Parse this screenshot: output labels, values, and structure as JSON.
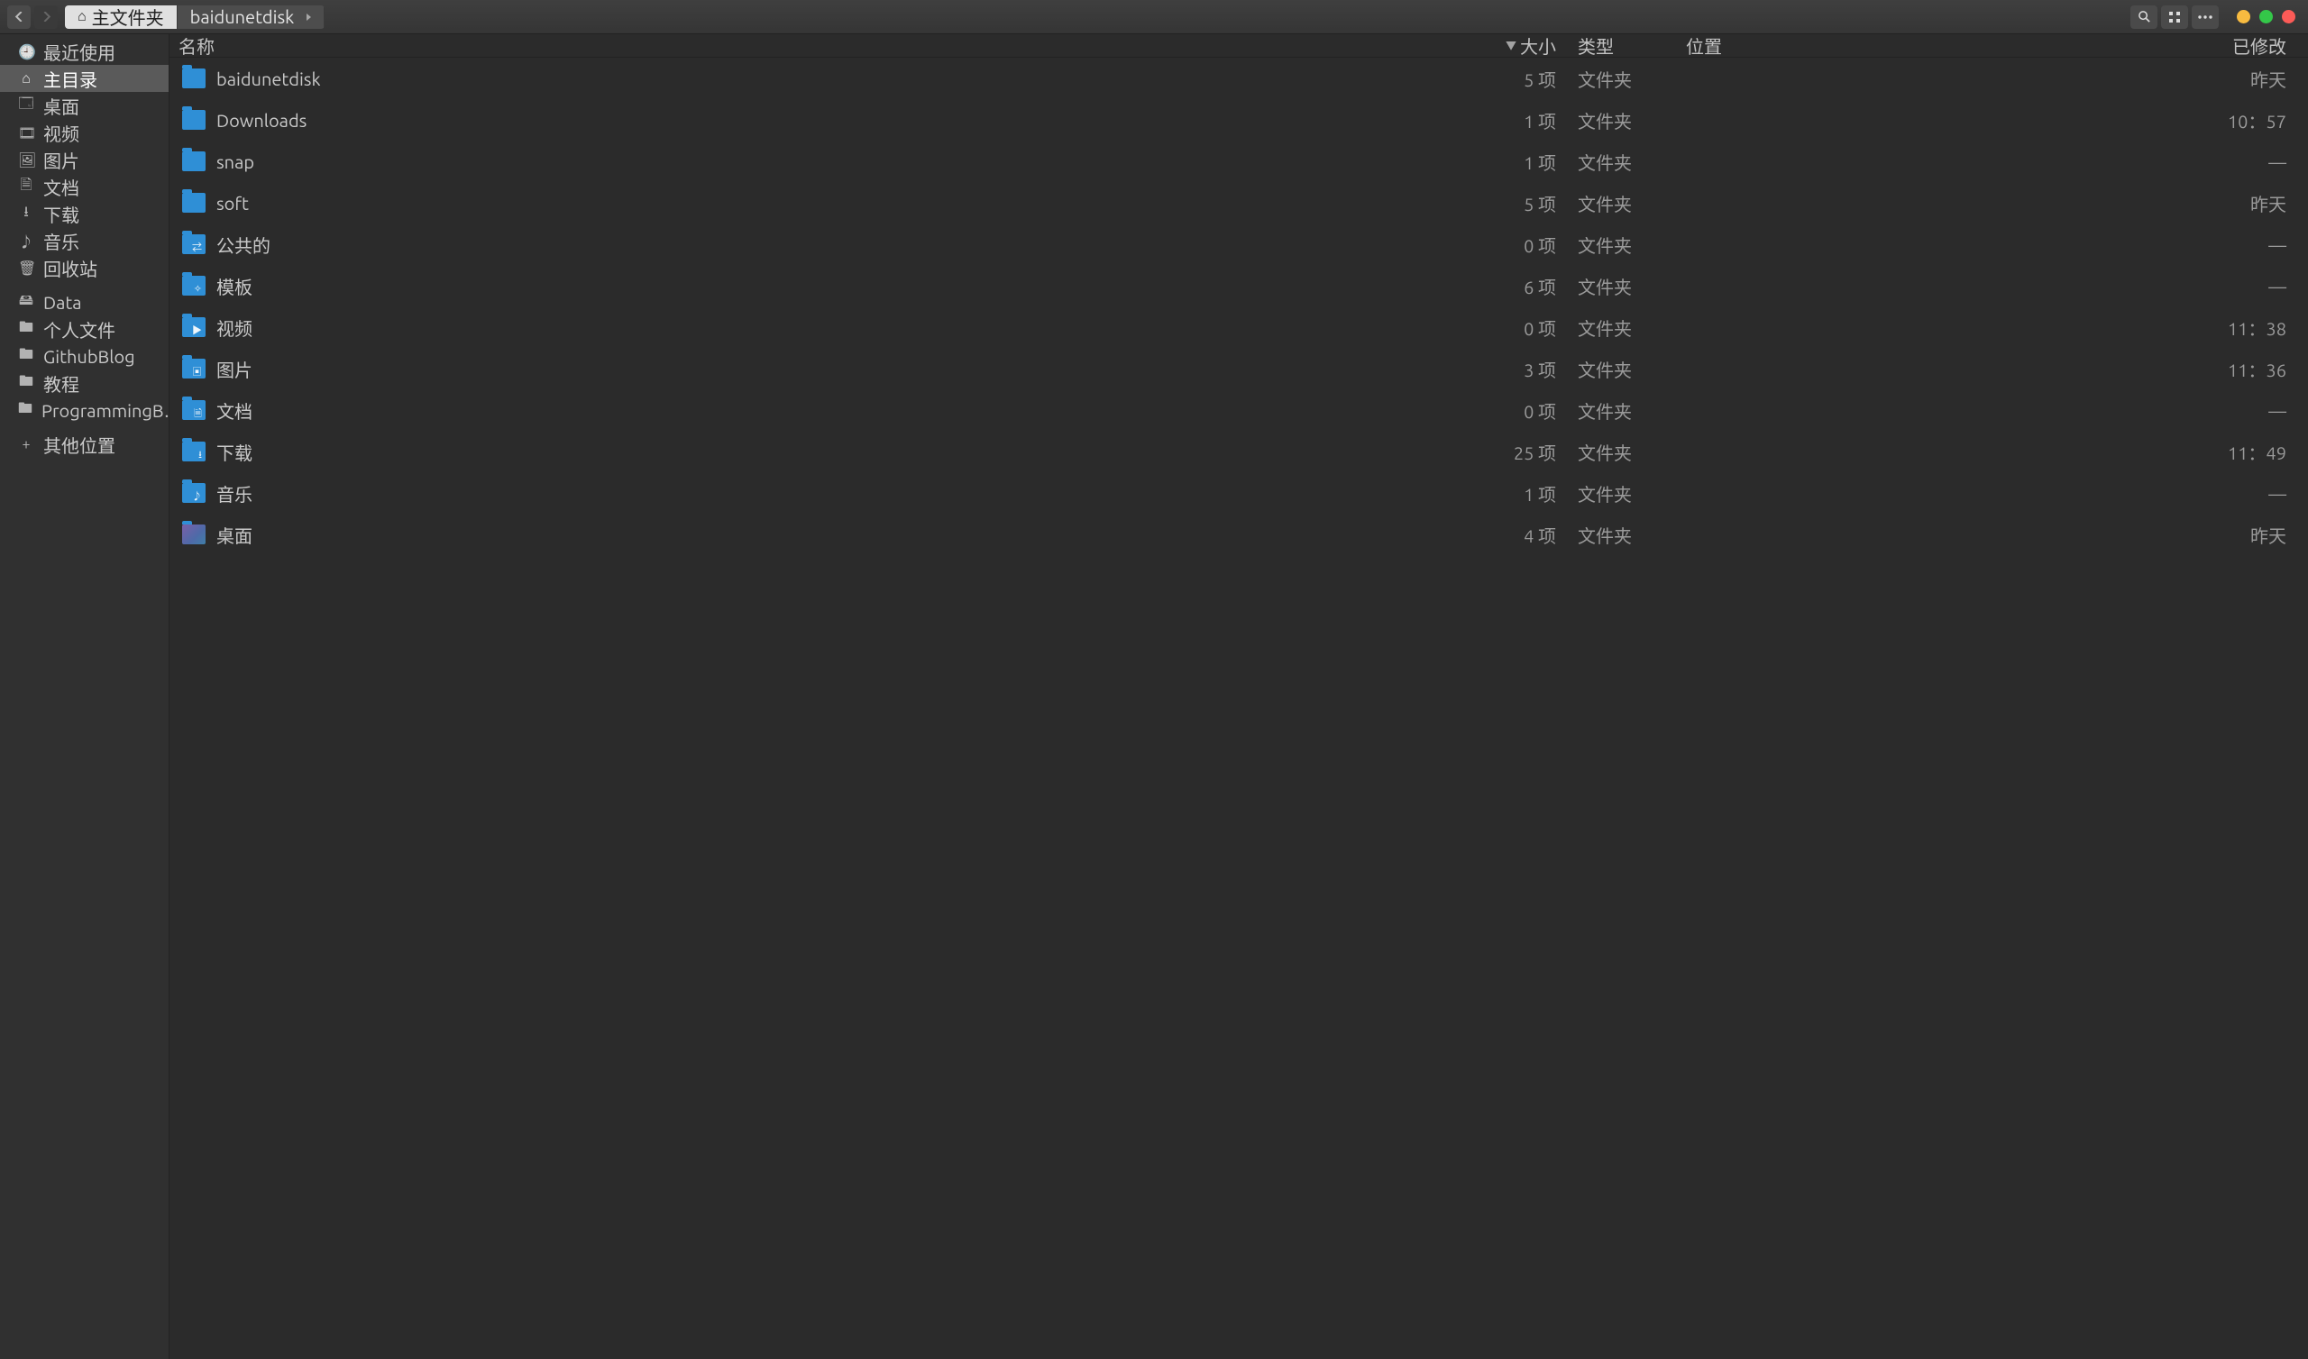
{
  "toolbar": {
    "crumb_home": "主文件夹",
    "crumb_child": "baidunetdisk"
  },
  "columns": {
    "name": "名称",
    "size": "大小",
    "type": "类型",
    "location": "位置",
    "modified": "已修改"
  },
  "sidebar": {
    "items": [
      {
        "icon": "🕘",
        "label": "最近使用"
      },
      {
        "icon": "⌂",
        "label": "主目录",
        "active": true
      },
      {
        "icon": "🗔",
        "label": "桌面"
      },
      {
        "icon": "🎞",
        "label": "视频"
      },
      {
        "icon": "🖼",
        "label": "图片"
      },
      {
        "icon": "🗎",
        "label": "文档"
      },
      {
        "icon": "⭳",
        "label": "下载"
      },
      {
        "icon": "♪",
        "label": "音乐"
      },
      {
        "icon": "🗑",
        "label": "回收站"
      }
    ],
    "items2": [
      {
        "icon": "🖴",
        "label": "Data"
      },
      {
        "icon": "🖿",
        "label": "个人文件"
      },
      {
        "icon": "🖿",
        "label": "GithubBlog"
      },
      {
        "icon": "🖿",
        "label": "教程"
      },
      {
        "icon": "🖿",
        "label": "ProgrammingB…"
      }
    ],
    "other": {
      "icon": "+",
      "label": "其他位置"
    }
  },
  "rows": [
    {
      "name": "baidunetdisk",
      "size": "5 项",
      "type": "文件夹",
      "mod": "昨天",
      "glyph": ""
    },
    {
      "name": "Downloads",
      "size": "1 项",
      "type": "文件夹",
      "mod": "10：57",
      "glyph": ""
    },
    {
      "name": "snap",
      "size": "1 项",
      "type": "文件夹",
      "mod": "—",
      "glyph": ""
    },
    {
      "name": "soft",
      "size": "5 项",
      "type": "文件夹",
      "mod": "昨天",
      "glyph": ""
    },
    {
      "name": "公共的",
      "size": "0 项",
      "type": "文件夹",
      "mod": "—",
      "glyph": "⇄"
    },
    {
      "name": "模板",
      "size": "6 项",
      "type": "文件夹",
      "mod": "—",
      "glyph": "✧"
    },
    {
      "name": "视频",
      "size": "0 项",
      "type": "文件夹",
      "mod": "11：38",
      "glyph": "▶"
    },
    {
      "name": "图片",
      "size": "3 项",
      "type": "文件夹",
      "mod": "11：36",
      "glyph": "▣"
    },
    {
      "name": "文档",
      "size": "0 项",
      "type": "文件夹",
      "mod": "—",
      "glyph": "🗎"
    },
    {
      "name": "下载",
      "size": "25 项",
      "type": "文件夹",
      "mod": "11：49",
      "glyph": "⭳"
    },
    {
      "name": "音乐",
      "size": "1 项",
      "type": "文件夹",
      "mod": "—",
      "glyph": "♪"
    },
    {
      "name": "桌面",
      "size": "4 项",
      "type": "文件夹",
      "mod": "昨天",
      "glyph": "",
      "desktop": true
    }
  ]
}
